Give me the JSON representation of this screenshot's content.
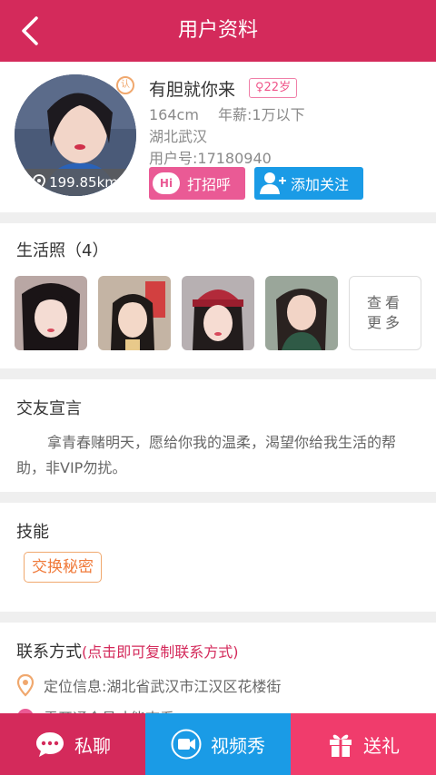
{
  "header": {
    "title": "用户资料"
  },
  "profile": {
    "nickname": "有胆就你来",
    "gender_age": "♀22岁",
    "height_salary": "164cm　 年薪:1万以下",
    "location": "湖北武汉",
    "user_id": "用户号:17180940",
    "distance": "199.85km",
    "verified_badge": "认",
    "greet_label": "打招呼",
    "greet_icon_text": "Hi",
    "follow_label": "添加关注"
  },
  "photos": {
    "title": "生活照（4）",
    "more_label": "查看更多"
  },
  "motto": {
    "title": "交友宣言",
    "text": "拿青春赌明天，愿给你我的温柔，渴望你给我生活的帮助，非VIP勿扰。"
  },
  "skills": {
    "title": "技能",
    "tags": [
      "交换秘密"
    ]
  },
  "contact": {
    "title": "联系方式",
    "hint": "(点击即可复制联系方式)",
    "location_text": "定位信息:湖北省武汉市江汉区花楼街",
    "second_text": "需开通会员才能查看"
  },
  "bottom_bar": {
    "chat_label": "私聊",
    "video_label": "视频秀",
    "gift_label": "送礼"
  },
  "colors": {
    "primary": "#d42a5b",
    "blue": "#1a9be6",
    "pink_btn": "#ea5a95",
    "orange_tag": "#f07a3a"
  }
}
